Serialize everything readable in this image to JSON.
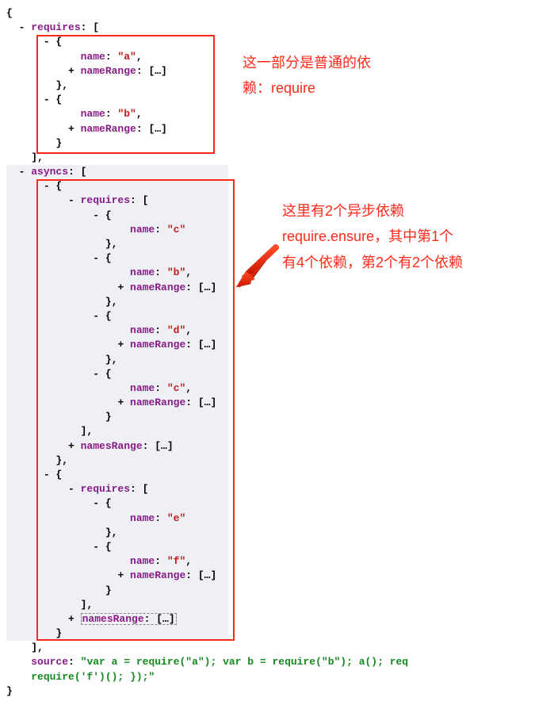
{
  "code": {
    "l1": "{",
    "l2": "  - ",
    "requires": "requires",
    "colon_br": ": [",
    "l3_open": "      - {",
    "name": "name",
    "nameRange": "nameRange",
    "ellipsis": "[…]",
    "a": "\"a\"",
    "b": "\"b\"",
    "c": "\"c\"",
    "d": "\"d\"",
    "e": "\"e\"",
    "f": "\"f\"",
    "close_br": "        },",
    "close_arr": "    ],",
    "asyncs": "asyncs",
    "namesRange": "namesRange",
    "source": "source",
    "source_val_1": "\"var a = require(\"a\"); var b = require(\"b\"); a(); req",
    "source_val_2": "require('f')(); });\"",
    "close": "}",
    "plus": "+ ",
    "dash": "- ",
    "comma": ",",
    "colon": ": ",
    "open_obj": "{",
    "close_obj": "}"
  },
  "annotations": {
    "top1": "这一部分是普通的依",
    "top2": "赖：require",
    "bot1": "这里有2个异步依赖",
    "bot2": "require.ensure，其中第1个",
    "bot3": "有4个依赖，第2个有2个依赖"
  }
}
